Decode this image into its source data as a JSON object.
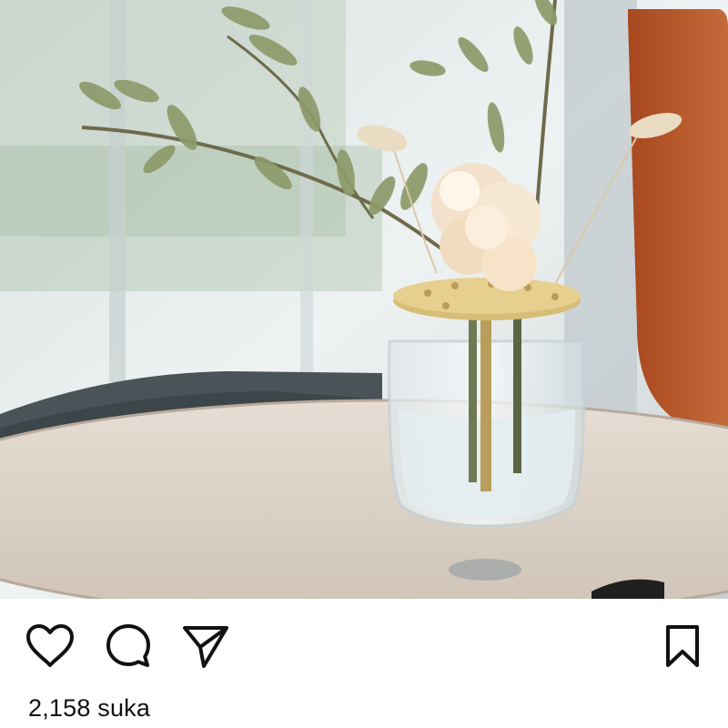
{
  "post": {
    "image": {
      "description_icon": "photo"
    },
    "actions": {
      "like_icon": "heart-icon",
      "comment_icon": "comment-icon",
      "share_icon": "send-icon",
      "save_icon": "bookmark-icon"
    },
    "likes_text": "2,158 suka"
  },
  "colors": {
    "icon": "#111111",
    "background": "#ffffff",
    "accent_chair": "#b5532a"
  }
}
